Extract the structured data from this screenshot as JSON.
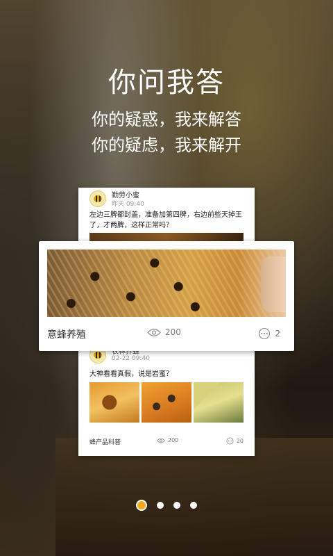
{
  "header": {
    "title": "你问我答",
    "subtitle_line1": "你的疑惑，我来解答",
    "subtitle_line2": "你的疑虑，我来解开"
  },
  "card_top": {
    "username": "勤劳小蜜",
    "time": "昨天 09:40",
    "text": "左边三脾都封盖，准备加第四脾，右边前些天掉王了，才两脾，这样正常吗？"
  },
  "card_main": {
    "category": "意蜂养殖",
    "views": "200",
    "comments": "2"
  },
  "card_bottom": {
    "username": "农林养蜂",
    "time": "02-22 09:40",
    "text": "大神看看真假，说是岩蜜？",
    "category": "蜂产品科普",
    "views": "200",
    "comments": "20"
  },
  "pagination": {
    "total": 4,
    "active_index": 0
  },
  "icons": [
    "eye-icon",
    "comment-icon",
    "bee-avatar-icon"
  ],
  "colors": {
    "accent": "#f2a81e",
    "card_bg": "#ffffff"
  }
}
